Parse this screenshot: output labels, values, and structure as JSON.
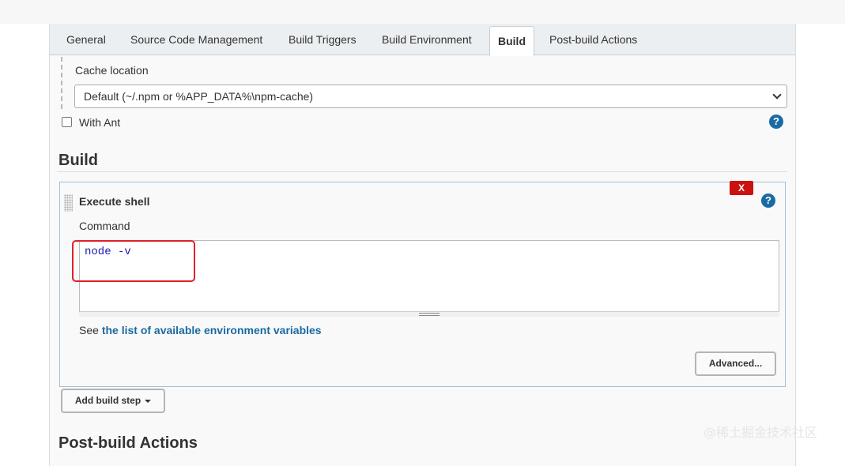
{
  "tabs": [
    {
      "label": "General"
    },
    {
      "label": "Source Code Management"
    },
    {
      "label": "Build Triggers"
    },
    {
      "label": "Build Environment"
    },
    {
      "label": "Build"
    },
    {
      "label": "Post-build Actions"
    }
  ],
  "active_tab": "Build",
  "npm_cache": {
    "label": "Cache location",
    "selected": "Default (~/.npm or %APP_DATA%\\npm-cache)"
  },
  "with_ant": {
    "label": "With Ant",
    "checked": false
  },
  "help_icon": "?",
  "build_section": {
    "title": "Build"
  },
  "execute_shell": {
    "title": "Execute shell",
    "delete_label": "X",
    "command_label": "Command",
    "command_value": "node -v",
    "see_prefix": "See",
    "env_link": "the list of available environment variables",
    "advanced_label": "Advanced..."
  },
  "add_build_step_label": "Add build step",
  "post_build_section": {
    "title": "Post-build Actions"
  },
  "watermark": "@稀土掘金技术社区",
  "colors": {
    "highlight": "#e0202a",
    "link": "#1a6aa3",
    "delete": "#cc1111"
  }
}
